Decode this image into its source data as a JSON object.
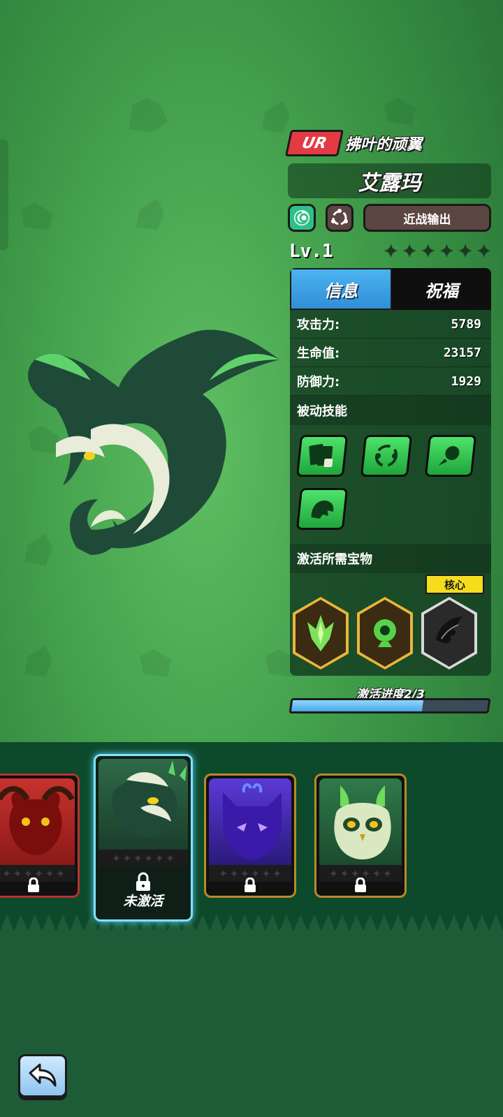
{
  "hero": {
    "rarity": "UR",
    "subtitle": "拂叶的顽翼",
    "name": "艾露玛",
    "role": "近战输出",
    "level": "Lv.1",
    "star_count": 6,
    "element_icon": "wind-swirl-icon",
    "class_icon": "cycle-arrows-icon"
  },
  "tabs": [
    {
      "label": "信息",
      "active": true
    },
    {
      "label": "祝福",
      "active": false
    }
  ],
  "stats": [
    {
      "label": "攻击力:",
      "value": "5789"
    },
    {
      "label": "生命值:",
      "value": "23157"
    },
    {
      "label": "防御力:",
      "value": "1929"
    }
  ],
  "passive_section_title": "被动技能",
  "passive_skills": [
    "cards-dice-icon",
    "orbit-icon",
    "fireball-icon",
    "monster-roar-icon"
  ],
  "treasure_section_title": "激活所需宝物",
  "treasures": [
    {
      "icon": "green-crystal-claw-icon",
      "status": "owned"
    },
    {
      "icon": "green-eye-orb-icon",
      "status": "owned"
    },
    {
      "icon": "dragon-wing-icon",
      "status": "missing"
    }
  ],
  "core_tag": "核心",
  "progress": {
    "label": "激活进度2/3",
    "fraction": 0.667
  },
  "carousel": [
    {
      "name": "red-demon",
      "locked": true,
      "selected": false
    },
    {
      "name": "green-dragon",
      "locked": true,
      "selected": true,
      "label": "未激活"
    },
    {
      "name": "purple-dragon",
      "locked": true,
      "selected": false
    },
    {
      "name": "green-owl",
      "locked": true,
      "selected": false
    }
  ],
  "colors": {
    "rarity": "#e23b44",
    "tab_active": "#3fa3e8",
    "skill_green": "#2fc04f",
    "progress_fill": "#6dbef0",
    "core_tag": "#f5dd1e"
  }
}
